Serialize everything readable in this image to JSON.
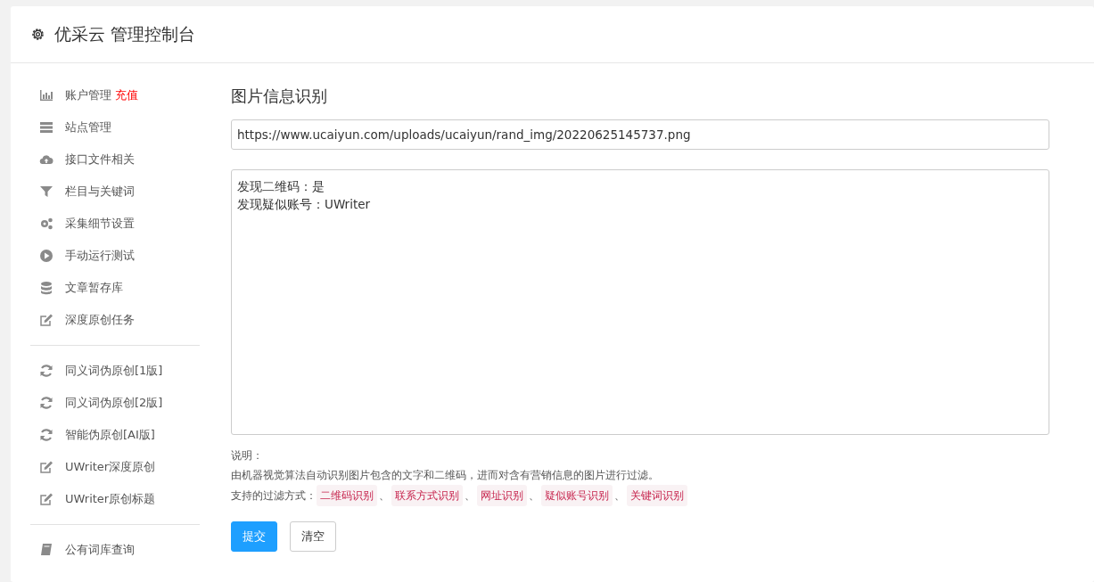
{
  "header": {
    "title": "优采云 管理控制台"
  },
  "sidebar": {
    "groups": [
      {
        "items": [
          {
            "kind": "chart",
            "label": "账户管理",
            "badge": "充值"
          },
          {
            "kind": "server",
            "label": "站点管理"
          },
          {
            "kind": "cloud",
            "label": "接口文件相关"
          },
          {
            "kind": "filter",
            "label": "栏目与关键词"
          },
          {
            "kind": "gears",
            "label": "采集细节设置"
          },
          {
            "kind": "play",
            "label": "手动运行测试"
          },
          {
            "kind": "database",
            "label": "文章暂存库"
          },
          {
            "kind": "edit",
            "label": "深度原创任务"
          }
        ]
      },
      {
        "items": [
          {
            "kind": "refresh",
            "label": "同义词伪原创[1版]"
          },
          {
            "kind": "refresh",
            "label": "同义词伪原创[2版]"
          },
          {
            "kind": "refresh",
            "label": "智能伪原创[AI版]"
          },
          {
            "kind": "edit",
            "label": "UWriter深度原创"
          },
          {
            "kind": "edit",
            "label": "UWriter原创标题"
          }
        ]
      },
      {
        "items": [
          {
            "kind": "book",
            "label": "公有词库查询"
          }
        ]
      }
    ]
  },
  "main": {
    "title": "图片信息识别",
    "url_field": {
      "value": "https://www.ucaiyun.com/uploads/ucaiyun/rand_img/20220625145737.png"
    },
    "result_box": {
      "lines": [
        "发现二维码：是",
        "发现疑似账号：UWriter"
      ]
    },
    "note_label": "说明：",
    "note_text": "由机器视觉算法自动识别图片包含的文字和二维码，进而对含有营销信息的图片进行过滤。",
    "methods_label": "支持的过滤方式：",
    "methods": [
      "二维码识别",
      "联系方式识别",
      "网址识别",
      "疑似账号识别",
      "关键词识别"
    ],
    "separator": "、",
    "buttons": [
      {
        "label": "提交",
        "kind": "primary"
      },
      {
        "label": "清空",
        "kind": "default"
      }
    ]
  }
}
